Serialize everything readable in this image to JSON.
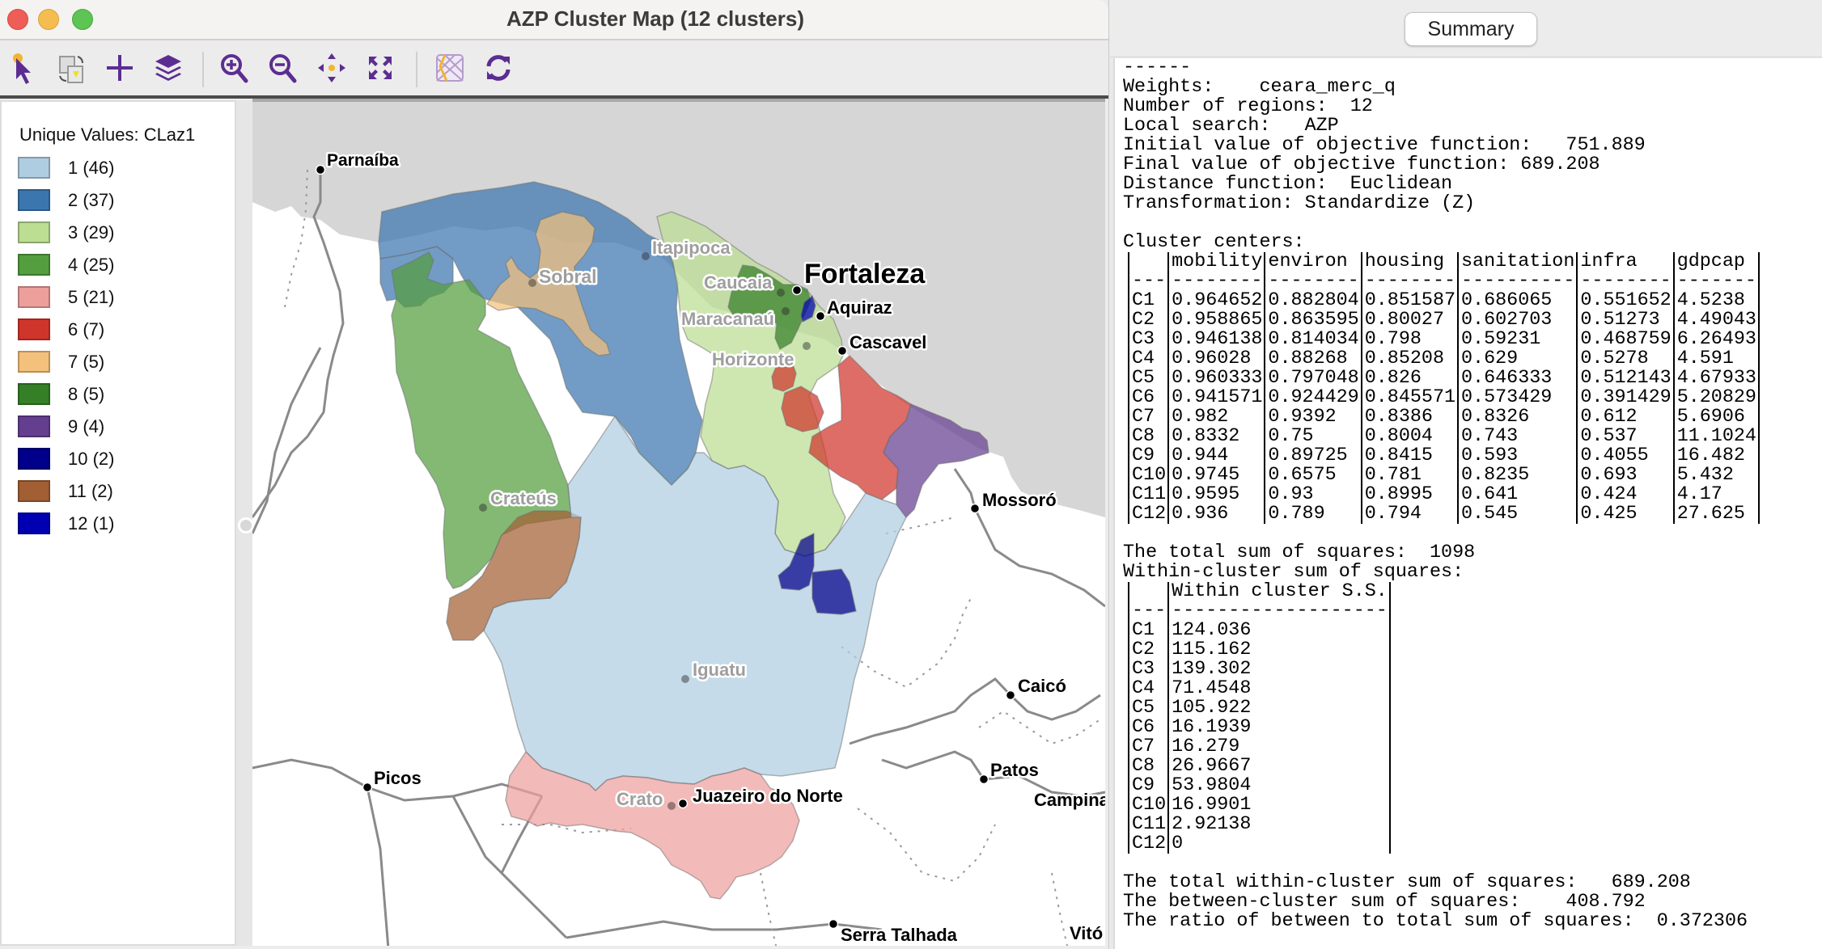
{
  "window": {
    "title": "AZP Cluster Map (12 clusters)"
  },
  "toolbar": {
    "items": [
      {
        "name": "select-tool",
        "icon": "pointer-icon"
      },
      {
        "name": "selection-shape",
        "icon": "select-shape-icon"
      },
      {
        "name": "add",
        "icon": "plus-icon"
      },
      {
        "name": "layers",
        "icon": "layers-icon"
      },
      {
        "name": "zoom-in",
        "icon": "zoom-in-icon"
      },
      {
        "name": "zoom-out",
        "icon": "zoom-out-icon"
      },
      {
        "name": "pan",
        "icon": "pan-icon"
      },
      {
        "name": "full-extent",
        "icon": "full-extent-icon"
      },
      {
        "name": "basemap",
        "icon": "basemap-icon"
      },
      {
        "name": "refresh",
        "icon": "refresh-icon"
      }
    ]
  },
  "legend": {
    "title": "Unique Values: CLaz1",
    "items": [
      {
        "label": "1 (46)",
        "color": "#aecde1"
      },
      {
        "label": "2 (37)",
        "color": "#3b76af"
      },
      {
        "label": "3 (29)",
        "color": "#bbde93"
      },
      {
        "label": "4 (25)",
        "color": "#559e3f"
      },
      {
        "label": "5 (21)",
        "color": "#ed9f9c"
      },
      {
        "label": "6 (7)",
        "color": "#d0352b"
      },
      {
        "label": "7 (5)",
        "color": "#f3c17b"
      },
      {
        "label": "8 (5)",
        "color": "#357f27"
      },
      {
        "label": "9 (4)",
        "color": "#643f90"
      },
      {
        "label": "10 (2)",
        "color": "#00008b"
      },
      {
        "label": "11 (2)",
        "color": "#a25f34"
      },
      {
        "label": "12 (1)",
        "color": "#0000b2"
      }
    ]
  },
  "map": {
    "sea_color": "#d6d6d6",
    "cities": [
      {
        "name": "Parnaíba",
        "style": "base"
      },
      {
        "name": "Sobral",
        "style": "cluster"
      },
      {
        "name": "Itapipoca",
        "style": "cluster"
      },
      {
        "name": "Caucaia",
        "style": "cluster"
      },
      {
        "name": "Fortaleza",
        "style": "major"
      },
      {
        "name": "Aquiraz",
        "style": "base"
      },
      {
        "name": "Maracanaú",
        "style": "cluster"
      },
      {
        "name": "Cascavel",
        "style": "base"
      },
      {
        "name": "Horizonte",
        "style": "cluster"
      },
      {
        "name": "Crateús",
        "style": "cluster"
      },
      {
        "name": "Mossoró",
        "style": "base"
      },
      {
        "name": "Iguatu",
        "style": "cluster"
      },
      {
        "name": "Caicó",
        "style": "base"
      },
      {
        "name": "Picos",
        "style": "base"
      },
      {
        "name": "Patos",
        "style": "base"
      },
      {
        "name": "Campina",
        "style": "base"
      },
      {
        "name": "Crato",
        "style": "cluster"
      },
      {
        "name": "Juazeiro do Norte",
        "style": "base"
      },
      {
        "name": "Serra Talhada",
        "style": "base"
      },
      {
        "name": "Vitó",
        "style": "base"
      }
    ]
  },
  "summary": {
    "tab_label": "Summary",
    "header_lines": [
      "------",
      "Weights:    ceara_merc_q",
      "Number of regions:  12",
      "Local search:   AZP",
      "Initial value of objective function:   751.889",
      "Final value of objective function: 689.208",
      "Distance function:  Euclidean",
      "Transformation: Standardize (Z)",
      "",
      "Cluster centers:"
    ],
    "centers_table": {
      "columns": [
        "",
        "mobility",
        "environ",
        "housing",
        "sanitation",
        "infra",
        "gdpcap"
      ],
      "separators": [
        "---",
        "--------",
        "--------",
        "--------",
        "----------",
        "--------",
        "-------"
      ],
      "rows": [
        [
          "C1",
          "0.964652",
          "0.882804",
          "0.851587",
          "0.686065",
          "0.551652",
          "4.5238"
        ],
        [
          "C2",
          "0.958865",
          "0.863595",
          "0.80027",
          "0.602703",
          "0.51273",
          "4.49043"
        ],
        [
          "C3",
          "0.946138",
          "0.814034",
          "0.798",
          "0.59231",
          "0.468759",
          "6.26493"
        ],
        [
          "C4",
          "0.96028",
          "0.88268",
          "0.85208",
          "0.629",
          "0.5278",
          "4.591"
        ],
        [
          "C5",
          "0.960333",
          "0.797048",
          "0.826",
          "0.646333",
          "0.512143",
          "4.67933"
        ],
        [
          "C6",
          "0.941571",
          "0.924429",
          "0.845571",
          "0.573429",
          "0.391429",
          "5.20829"
        ],
        [
          "C7",
          "0.982",
          "0.9392",
          "0.8386",
          "0.8326",
          "0.612",
          "5.6906"
        ],
        [
          "C8",
          "0.8332",
          "0.75",
          "0.8004",
          "0.743",
          "0.537",
          "11.1024"
        ],
        [
          "C9",
          "0.944",
          "0.89725",
          "0.8415",
          "0.593",
          "0.4055",
          "16.482"
        ],
        [
          "C10",
          "0.9745",
          "0.6575",
          "0.781",
          "0.8235",
          "0.693",
          "5.432"
        ],
        [
          "C11",
          "0.9595",
          "0.93",
          "0.8995",
          "0.641",
          "0.424",
          "4.17"
        ],
        [
          "C12",
          "0.936",
          "0.789",
          "0.794",
          "0.545",
          "0.425",
          "27.625"
        ]
      ]
    },
    "total_ss_line": "The total sum of squares:  1098",
    "within_title": "Within-cluster sum of squares:",
    "within_table": {
      "columns": [
        "",
        "Within cluster S.S."
      ],
      "separators": [
        "---",
        "-------------------"
      ],
      "rows": [
        [
          "C1",
          "124.036"
        ],
        [
          "C2",
          "115.162"
        ],
        [
          "C3",
          "139.302"
        ],
        [
          "C4",
          "71.4548"
        ],
        [
          "C5",
          "105.922"
        ],
        [
          "C6",
          "16.1939"
        ],
        [
          "C7",
          "16.279"
        ],
        [
          "C8",
          "26.9667"
        ],
        [
          "C9",
          "53.9804"
        ],
        [
          "C10",
          "16.9901"
        ],
        [
          "C11",
          "2.92138"
        ],
        [
          "C12",
          "0"
        ]
      ]
    },
    "footer_lines": [
      "The total within-cluster sum of squares:   689.208",
      "The between-cluster sum of squares:    408.792",
      "The ratio of between to total sum of squares:  0.372306"
    ]
  }
}
